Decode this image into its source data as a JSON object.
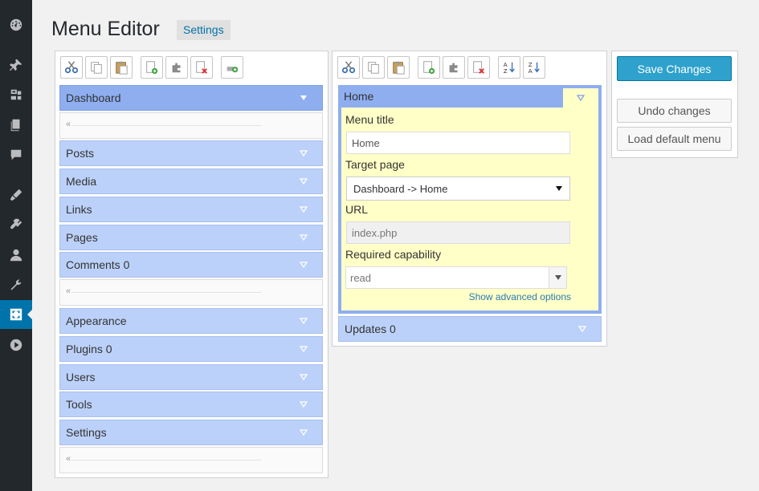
{
  "header": {
    "title": "Menu Editor",
    "settings_label": "Settings"
  },
  "sidebar_icons": [
    "dashboard-icon",
    "pin-icon",
    "media-icon",
    "pages-icon",
    "comments-icon",
    "appearance-icon",
    "plugins-icon",
    "users-icon",
    "tools-icon",
    "menu-editor-icon",
    "play-icon"
  ],
  "left_toolbar": [
    "cut-icon",
    "copy-icon",
    "paste-icon",
    "new-menu-icon",
    "new-separator-icon",
    "delete-icon",
    "new-item-icon"
  ],
  "right_toolbar": [
    "cut-icon",
    "copy-icon",
    "paste-icon",
    "new-menu-icon",
    "new-separator-icon",
    "delete-icon",
    "sort-ascending-icon",
    "sort-descending-icon"
  ],
  "left_menu": {
    "items": [
      {
        "label": "Dashboard"
      },
      {
        "label": "Posts"
      },
      {
        "label": "Media"
      },
      {
        "label": "Links"
      },
      {
        "label": "Pages"
      },
      {
        "label": "Comments 0"
      },
      {
        "label": "Appearance"
      },
      {
        "label": "Plugins 0"
      },
      {
        "label": "Users"
      },
      {
        "label": "Tools"
      },
      {
        "label": "Settings"
      }
    ]
  },
  "right_menu": {
    "home_label": "Home",
    "fields": {
      "menu_title_label": "Menu title",
      "menu_title_value": "Home",
      "target_page_label": "Target page",
      "target_page_value": "Dashboard -> Home",
      "url_label": "URL",
      "url_value": "index.php",
      "capability_label": "Required capability",
      "capability_value": "read",
      "advanced_link": "Show advanced options"
    },
    "updates_label": "Updates 0"
  },
  "actions": {
    "save_label": "Save Changes",
    "undo_label": "Undo changes",
    "load_default_label": "Load default menu"
  },
  "colors": {
    "sidebar_bg": "#23282d",
    "accent": "#0073aa",
    "menu_item_bg": "#bcd1f9",
    "selected_item_bg": "#8eaef0",
    "editor_bg": "#ffffc8",
    "save_button_bg": "#2ea2cc"
  }
}
